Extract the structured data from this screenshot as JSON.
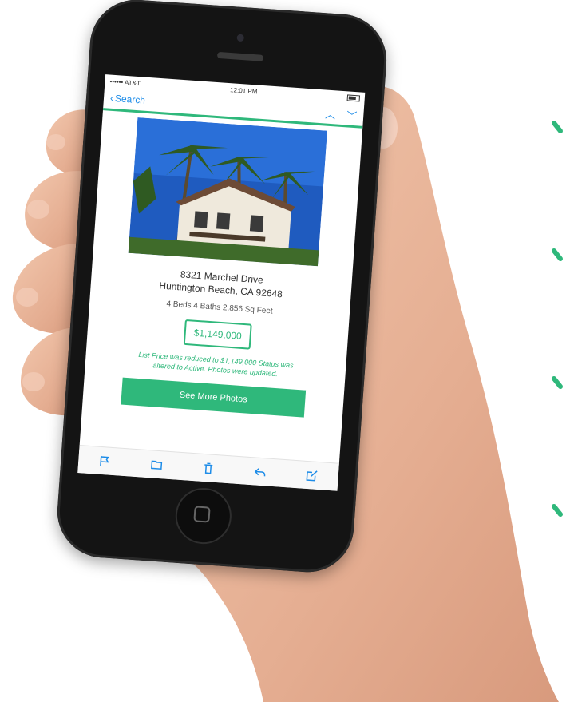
{
  "status_bar": {
    "carrier": "•••••• AT&T",
    "time": "12:01 PM",
    "battery": "⚡"
  },
  "nav_bar": {
    "back_label": "Search",
    "up_icon": "chevron-up-icon",
    "down_icon": "chevron-down-icon"
  },
  "listing": {
    "photo_icon": "house-photo-image",
    "address_line1": "8321 Marchel Drive",
    "address_line2": "Huntington Beach, CA 92648",
    "specs": "4 Beds 4 Baths 2,856 Sq Feet",
    "price": "$1,149,000",
    "change_note": "List Price was reduced to $1,149,000 Status was altered to Active. Photos were updated.",
    "cta_label": "See More Photos"
  },
  "toolbar": [
    {
      "name": "flag-icon"
    },
    {
      "name": "folder-icon"
    },
    {
      "name": "trash-icon"
    },
    {
      "name": "reply-icon"
    },
    {
      "name": "compose-icon"
    }
  ],
  "colors": {
    "accent_green": "#2fb87b",
    "ios_blue": "#1d8ce8",
    "phone_black": "#141414",
    "skin": "#e9b79a"
  }
}
